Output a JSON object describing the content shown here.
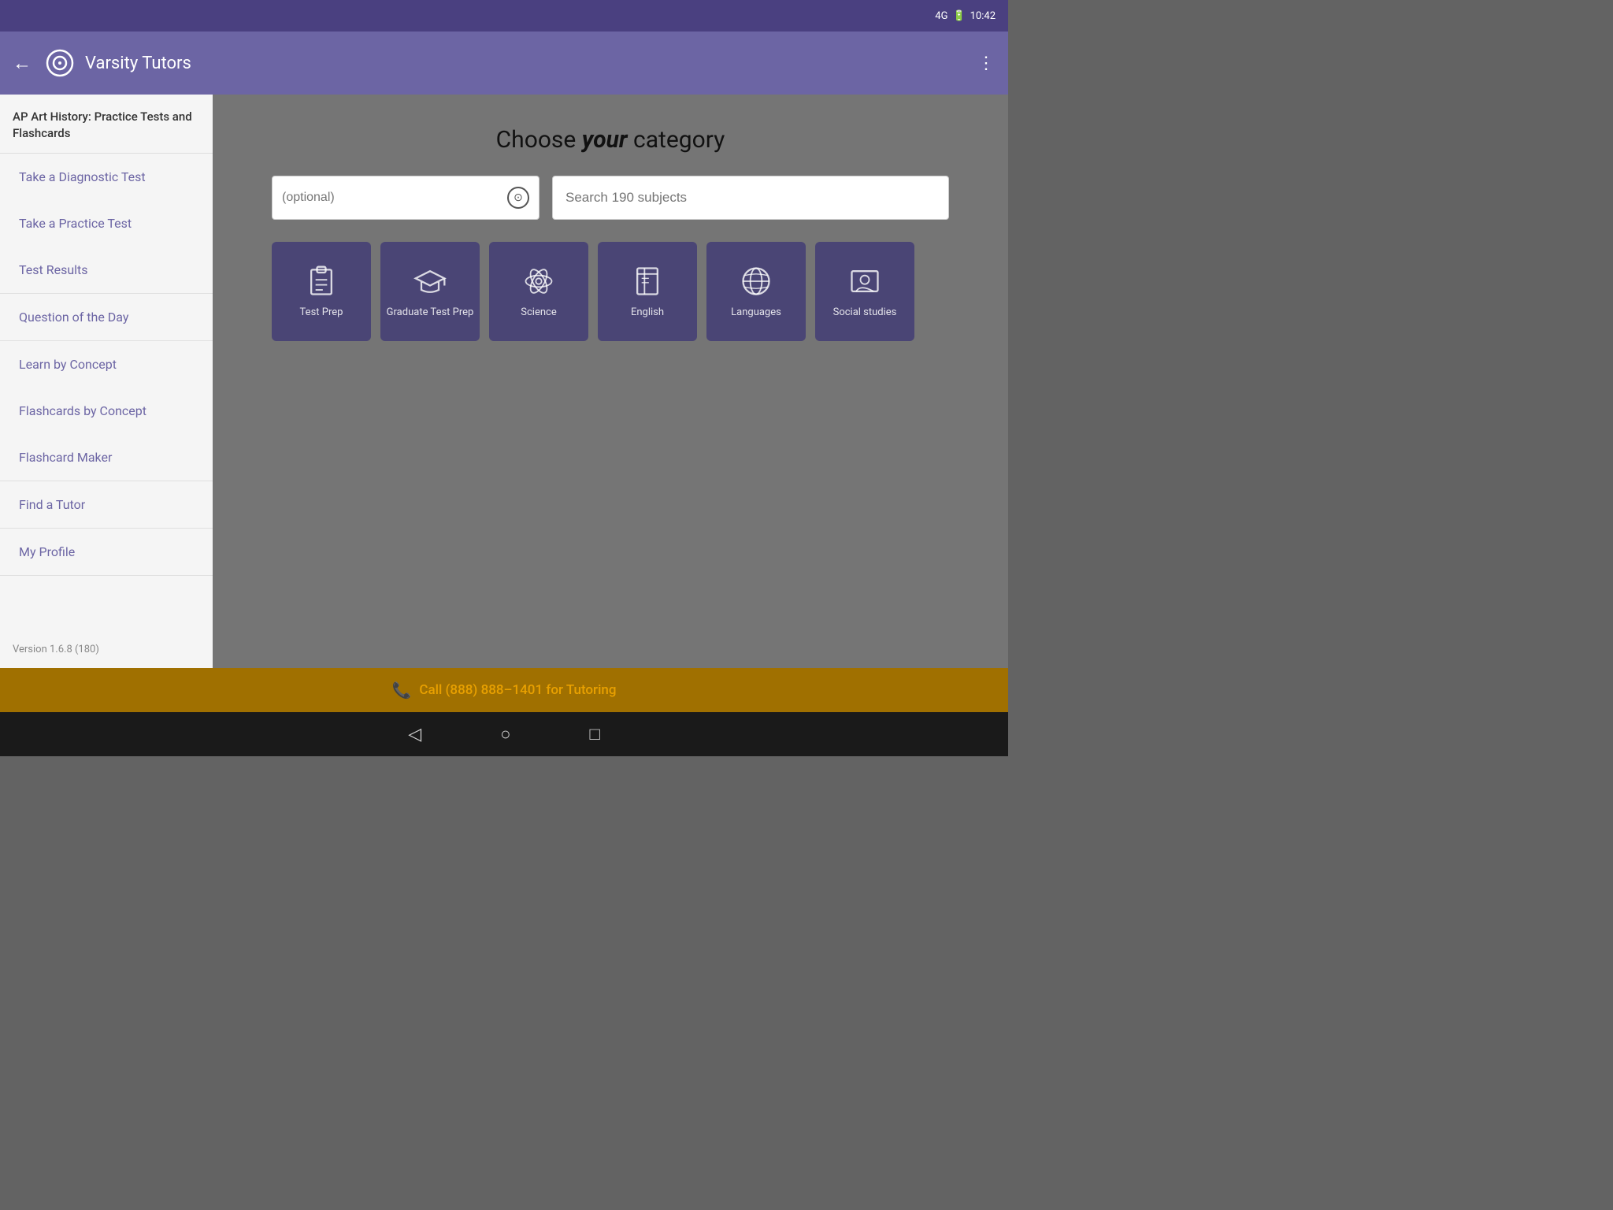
{
  "statusBar": {
    "signal": "4G",
    "battery": "🔋",
    "time": "10:42"
  },
  "appBar": {
    "title": "Varsity Tutors",
    "backLabel": "←",
    "menuLabel": "⋮"
  },
  "sidebar": {
    "header": "AP Art History: Practice Tests and Flashcards",
    "sections": [
      {
        "items": [
          "Take a Diagnostic Test",
          "Take a Practice Test",
          "Test Results"
        ]
      },
      {
        "items": [
          "Question of the Day"
        ]
      },
      {
        "items": [
          "Learn by Concept",
          "Flashcards by Concept",
          "Flashcard Maker"
        ]
      },
      {
        "items": [
          "Find a Tutor"
        ]
      },
      {
        "items": [
          "My Profile"
        ]
      }
    ],
    "version": "Version 1.6.8 (180)"
  },
  "content": {
    "title_prefix": "Choose ",
    "title_italic": "your",
    "title_suffix": " category",
    "searchPlaceholder": "(optional)",
    "search190Placeholder": "Search 190 subjects",
    "categories": [
      {
        "label": "Test Prep",
        "icon": "clipboard"
      },
      {
        "label": "Graduate Test Prep",
        "icon": "graduation"
      },
      {
        "label": "Science",
        "icon": "atom"
      },
      {
        "label": "English",
        "icon": "book"
      },
      {
        "label": "Languages",
        "icon": "globe"
      },
      {
        "label": "Social studies",
        "icon": "person-card"
      }
    ]
  },
  "bottomBar": {
    "text": "Call (888) 888–1401 for Tutoring"
  },
  "navBar": {
    "back": "◁",
    "home": "○",
    "recent": "□"
  }
}
